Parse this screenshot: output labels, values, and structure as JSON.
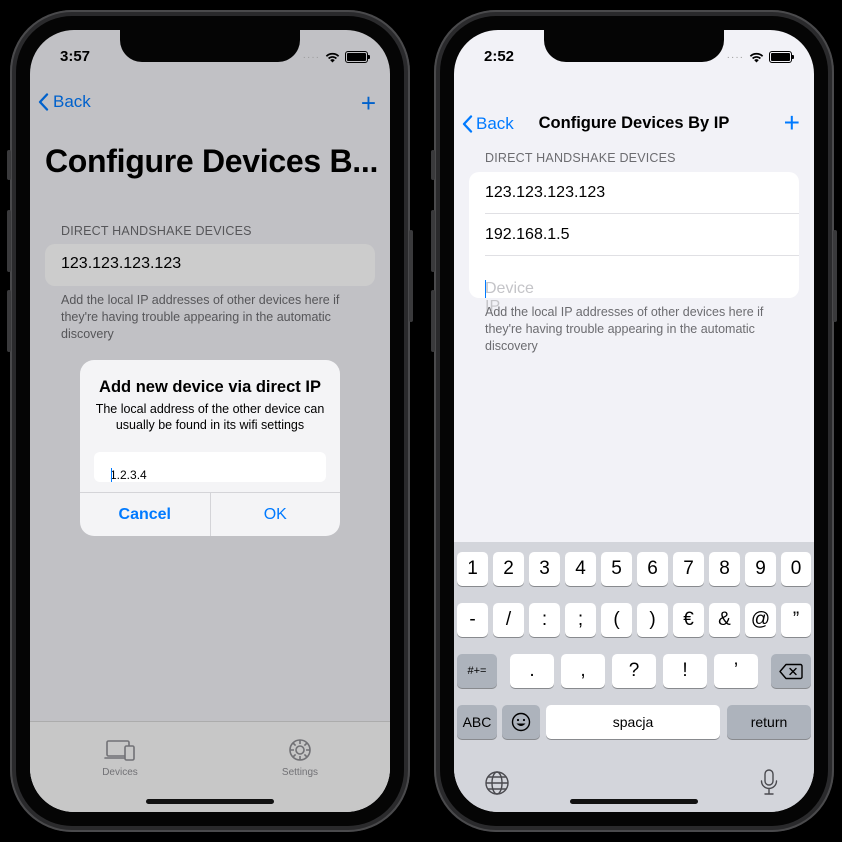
{
  "left_phone": {
    "status": {
      "time": "3:57"
    },
    "nav": {
      "back_label": "Back",
      "plus": "+"
    },
    "large_title": "Configure Devices B...",
    "section_header": "DIRECT HANDSHAKE DEVICES",
    "devices": [
      "123.123.123.123"
    ],
    "footer": "Add the local IP addresses of other devices here if they're having trouble appearing in the automatic discovery",
    "tabs": [
      {
        "label": "Devices",
        "icon": "devices-icon"
      },
      {
        "label": "Settings",
        "icon": "gear-icon"
      }
    ],
    "alert": {
      "title": "Add new device via direct IP",
      "message": "The local address of the other device can usually be found in its wifi settings",
      "input_value": "1.2.3.4",
      "cancel_label": "Cancel",
      "ok_label": "OK"
    }
  },
  "right_phone": {
    "status": {
      "time": "2:52"
    },
    "nav": {
      "back_label": "Back",
      "title": "Configure Devices By IP",
      "plus": "+"
    },
    "section_header": "DIRECT HANDSHAKE DEVICES",
    "devices": [
      "123.123.123.123",
      "192.168.1.5"
    ],
    "input_placeholder": "Device IP",
    "footer": "Add the local IP addresses of other devices here if they're having trouble appearing in the automatic discovery",
    "keyboard": {
      "row1": [
        "1",
        "2",
        "3",
        "4",
        "5",
        "6",
        "7",
        "8",
        "9",
        "0"
      ],
      "row2": [
        "-",
        "/",
        ":",
        ";",
        "(",
        ")",
        "€",
        "&",
        "@",
        "”"
      ],
      "row3_left": "#+=",
      "row3": [
        ".",
        ",",
        "?",
        "!",
        "’"
      ],
      "abc": "ABC",
      "space": "spacja",
      "return": "return"
    }
  },
  "colors": {
    "accent": "#007aff",
    "background": "#f2f2f7",
    "keyboard": "#d3d5db"
  }
}
